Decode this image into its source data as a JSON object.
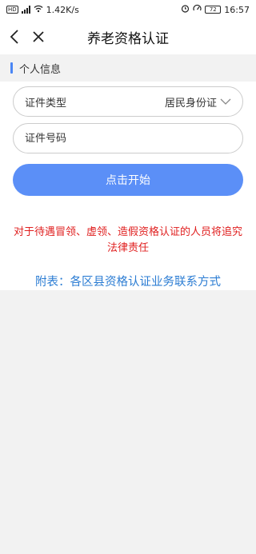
{
  "status_bar": {
    "network_speed": "1.42K/s",
    "battery": "72",
    "time": "16:57"
  },
  "nav": {
    "title": "养老资格认证"
  },
  "section": {
    "title": "个人信息"
  },
  "form": {
    "id_type_label": "证件类型",
    "id_type_value": "居民身份证",
    "id_number_placeholder": "证件号码",
    "start_button": "点击开始"
  },
  "warning_text": "对于待遇冒领、虚领、造假资格认证的人员将追究法律责任",
  "appendix_link": "附表：各区县资格认证业务联系方式",
  "colors": {
    "accent": "#5b8ff7",
    "warning": "#e02020",
    "link": "#2b7cd3"
  }
}
